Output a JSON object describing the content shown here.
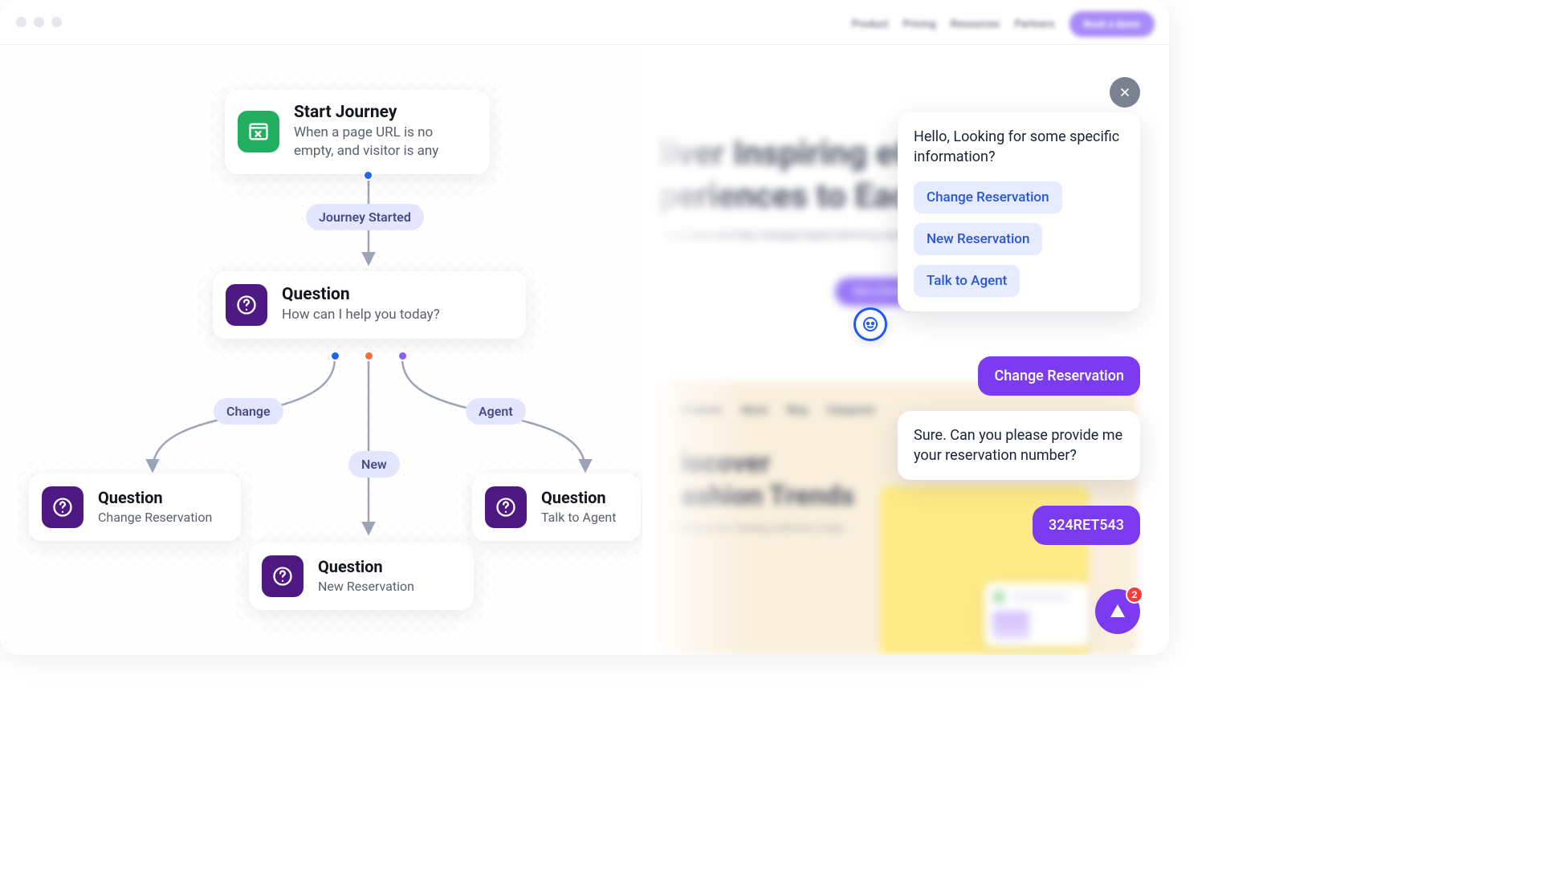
{
  "flow": {
    "start": {
      "title": "Start Journey",
      "subtitle": "When a page URL is no empty, and visitor is any"
    },
    "question": {
      "title": "Question",
      "subtitle": "How can I help you today?"
    },
    "branch_change": {
      "title": "Question",
      "subtitle": "Change Reservation"
    },
    "branch_new": {
      "title": "Question",
      "subtitle": "New Reservation"
    },
    "branch_agent": {
      "title": "Question",
      "subtitle": "Talk to Agent"
    },
    "pill_started": "Journey Started",
    "pill_change": "Change",
    "pill_new": "New",
    "pill_agent": "Agent"
  },
  "chat": {
    "greeting": "Hello, Looking for some specific information?",
    "options": {
      "change": "Change Reservation",
      "new": "New Reservation",
      "agent": "Talk to Agent"
    },
    "user_pick": "Change Reservation",
    "bot_followup": "Sure. Can you please provide me your reservation number?",
    "user_code": "324RET543",
    "badge_count": "2"
  },
  "bg": {
    "nav_product": "Product",
    "nav_pricing": "Pricing",
    "nav_resources": "Resources",
    "nav_partners": "Partners",
    "nav_cta": "Book a demo",
    "hero_line1": "liver Inspiring eC",
    "hero_line2": "periences to Each",
    "hero_sub": "innovation and fully managed digital delivering experiences that are fast",
    "hero_cta": "Get a Demo",
    "fashion_nav": {
      "a": "Products",
      "b": "About",
      "c": "Blog",
      "d": "Categories"
    },
    "fashion_h1": "iscover",
    "fashion_h2": "ashion Trends",
    "fashion_sub": "Browse Our Trending Collection Today"
  }
}
